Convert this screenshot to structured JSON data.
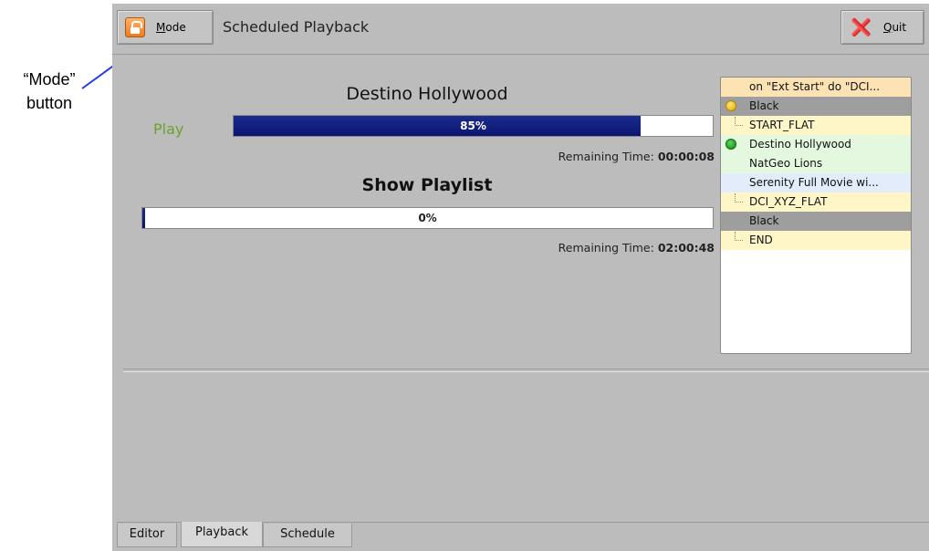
{
  "annotation": {
    "line1": "“Mode”",
    "line2": "button"
  },
  "toolbar": {
    "mode_label": "Mode",
    "title": "Scheduled Playback",
    "quit_label": "Quit",
    "mode_icon": "lock-icon",
    "quit_icon": "close-icon"
  },
  "playback": {
    "now_title": "Destino Hollywood",
    "state": "Play",
    "state_color": "#6aa32a",
    "current_progress_percent": 85,
    "current_progress_text": "85%",
    "current_remaining_label": "Remaining Time:",
    "current_remaining_value": "00:00:08",
    "playlist_title": "Show Playlist",
    "playlist_progress_percent": 0,
    "playlist_progress_text": "0%",
    "playlist_remaining_label": "Remaining Time:",
    "playlist_remaining_value": "02:00:48"
  },
  "playlist": [
    {
      "label": "on \"Ext Start\" do \"DCI...",
      "bg": "#fde2b4",
      "icon": "none"
    },
    {
      "label": "Black",
      "bg": "#9e9e9e",
      "icon": "yellow-dot-icon"
    },
    {
      "label": "START_FLAT",
      "bg": "#fff6c8",
      "icon": "tree-branch-icon"
    },
    {
      "label": "Destino Hollywood",
      "bg": "#e4f8e0",
      "icon": "green-dot-icon"
    },
    {
      "label": "NatGeo Lions",
      "bg": "#e4f8e0",
      "icon": "none"
    },
    {
      "label": "Serenity Full Movie wi...",
      "bg": "#e2ecfb",
      "icon": "none"
    },
    {
      "label": "DCI_XYZ_FLAT",
      "bg": "#fff6c8",
      "icon": "tree-branch-icon"
    },
    {
      "label": "Black",
      "bg": "#9e9e9e",
      "icon": "none"
    },
    {
      "label": "END",
      "bg": "#fff6c8",
      "icon": "tree-branch-icon"
    }
  ],
  "tabs": [
    {
      "label": "Editor",
      "active": false
    },
    {
      "label": "Playback",
      "active": true
    },
    {
      "label": "Schedule",
      "active": false
    }
  ]
}
